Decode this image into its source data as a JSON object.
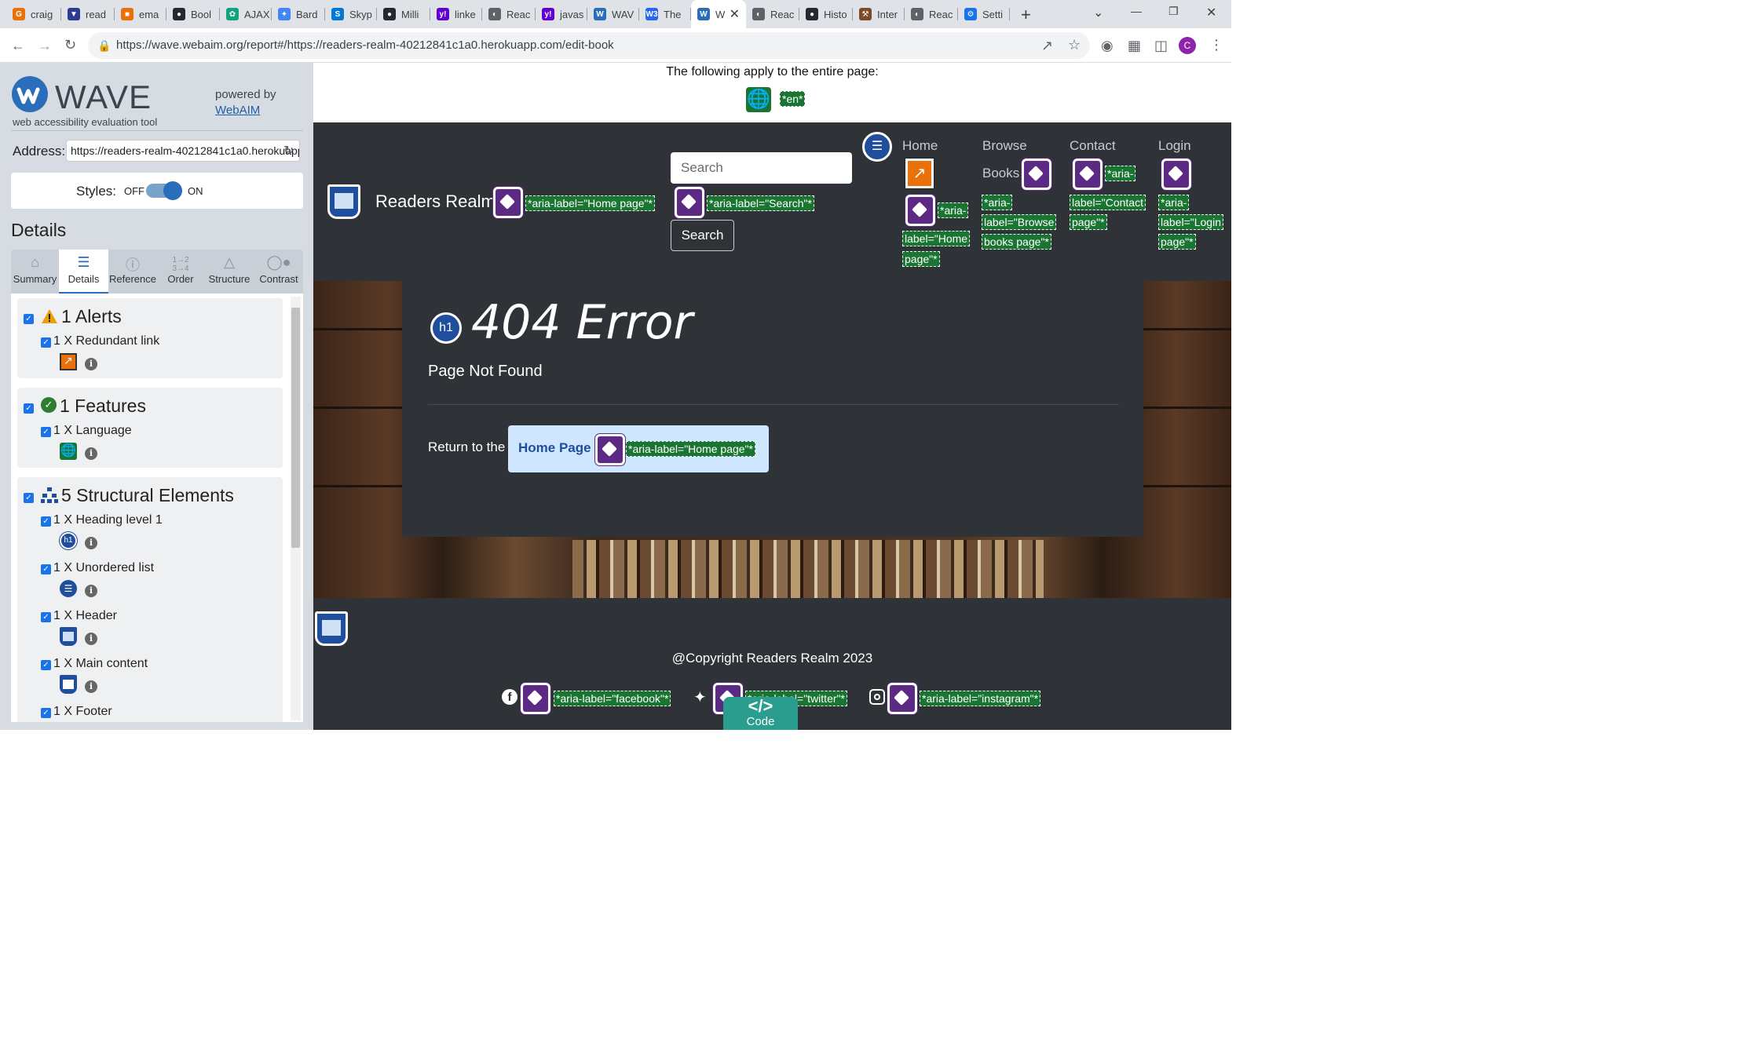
{
  "browser": {
    "tabs": [
      {
        "label": "craig",
        "color": "#e8710a",
        "glyph": "G"
      },
      {
        "label": "read",
        "color": "#2f3b8f",
        "glyph": "▼"
      },
      {
        "label": "ema",
        "color": "#e8710a",
        "glyph": "■"
      },
      {
        "label": "Bool",
        "color": "#24292f",
        "glyph": "●"
      },
      {
        "label": "AJAX",
        "color": "#10a37f",
        "glyph": "✿"
      },
      {
        "label": "Bard",
        "color": "#4285f4",
        "glyph": "✦"
      },
      {
        "label": "Skyp",
        "color": "#0078d4",
        "glyph": "S"
      },
      {
        "label": "Milli",
        "color": "#24292f",
        "glyph": "●"
      },
      {
        "label": "linke",
        "color": "#6001d2",
        "glyph": "y!"
      },
      {
        "label": "Reac",
        "color": "#5f6368",
        "glyph": "◐"
      },
      {
        "label": "javas",
        "color": "#6001d2",
        "glyph": "y!"
      },
      {
        "label": "WAV",
        "color": "#2a6ebb",
        "glyph": "W"
      },
      {
        "label": "The",
        "color": "#2965f1",
        "glyph": "W3"
      },
      {
        "label": "W",
        "color": "#2a6ebb",
        "glyph": "W"
      },
      {
        "label": "Reac",
        "color": "#5f6368",
        "glyph": "◐"
      },
      {
        "label": "Histo",
        "color": "#24292f",
        "glyph": "●"
      },
      {
        "label": "Inter",
        "color": "#7a4a2a",
        "glyph": "⚒"
      },
      {
        "label": "Reac",
        "color": "#5f6368",
        "glyph": "◐"
      },
      {
        "label": "Setti",
        "color": "#1a73e8",
        "glyph": "⚙"
      }
    ],
    "url": "https://wave.webaim.org/report#/https://readers-realm-40212841c1a0.herokuapp.com/edit-book",
    "profile_initial": "C"
  },
  "wave": {
    "logo": "WAVE",
    "subtitle": "web accessibility evaluation tool",
    "powered_by": "powered by",
    "webaim": "WebAIM",
    "address_label": "Address:",
    "address_value": "https://readers-realm-40212841c1a0.herokuapp.com/edit-book",
    "styles_label": "Styles:",
    "styles_off": "OFF",
    "styles_on": "ON",
    "details_heading": "Details",
    "tabs": [
      "Summary",
      "Details",
      "Reference",
      "Order",
      "Structure",
      "Contrast"
    ],
    "order_glyph": "1→2\n3→4",
    "groups": {
      "alerts": {
        "title": "1 Alerts",
        "items": [
          "1 X Redundant link"
        ]
      },
      "features": {
        "title": "1 Features",
        "items": [
          "1 X Language"
        ]
      },
      "structure": {
        "title": "5 Structural Elements",
        "items": [
          "1 X Heading level 1",
          "1 X Unordered list",
          "1 X Header",
          "1 X Main content",
          "1 X Footer"
        ]
      }
    },
    "code_label": "Code"
  },
  "page": {
    "applies_text": "The following apply to the entire page:",
    "lang_tag": "*en*",
    "brand": "Readers Realm",
    "brand_tag": "*aria-label=\"Home page\"*",
    "search_placeholder": "Search",
    "search_tag": "*aria-label=\"Search\"*",
    "search_button": "Search",
    "nav": {
      "home": "Home",
      "home_tag_1": "*aria-",
      "home_tag_2": "label=\"Home",
      "home_tag_3": "page\"*",
      "browse_1": "Browse",
      "browse_2": "Books",
      "browse_tag_1": "*aria-",
      "browse_tag_2": "label=\"Browse",
      "browse_tag_3": "books page\"*",
      "contact": "Contact",
      "contact_tag_1": "*aria-",
      "contact_tag_2": "label=\"Contact",
      "contact_tag_3": "page\"*",
      "login": "Login",
      "login_tag_1": "*aria-",
      "login_tag_2": "label=\"Login",
      "login_tag_3": "page\"*"
    },
    "error_title": "404 Error",
    "error_sub": "Page Not Found",
    "return_text": "Return to the",
    "home_link": "Home Page",
    "home_link_tag": "*aria-label=\"Home page\"*",
    "copyright": "@Copyright Readers Realm 2023",
    "social": {
      "facebook_tag": "*aria-label=\"facebook\"*",
      "twitter_tag": "*aria-label=\"twitter\"*",
      "instagram_tag": "*aria-label=\"instagram\"*"
    },
    "colors": {
      "header_bg": "#2f3237",
      "wave_tag_green": "#197531",
      "aria_purple": "#5c2a84",
      "structure_blue": "#1f4e9c",
      "alert_orange": "#e8710a",
      "link_bg": "#cfe6ff"
    }
  }
}
